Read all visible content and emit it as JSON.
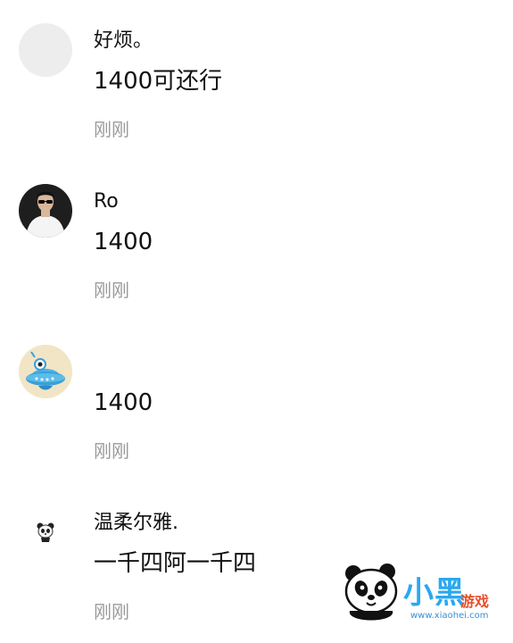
{
  "comments": [
    {
      "username": "好烦。",
      "content": "1400可还行",
      "time": "刚刚",
      "avatar": "blank-avatar"
    },
    {
      "username": "Ro",
      "content": "1400",
      "time": "刚刚",
      "avatar": "person-sunglasses-avatar"
    },
    {
      "username": "",
      "content": "1400",
      "time": "刚刚",
      "avatar": "cartoon-alien-ufo-avatar"
    },
    {
      "username": "温柔尔雅.",
      "content": "一千四阿一千四",
      "time": "刚刚",
      "avatar": "cartoon-panda-avatar"
    }
  ],
  "watermark": {
    "logo_text": "小黑",
    "sub_text": "游戏",
    "url": "www.xiaohei.com",
    "icon": "panda-mascot-icon"
  }
}
